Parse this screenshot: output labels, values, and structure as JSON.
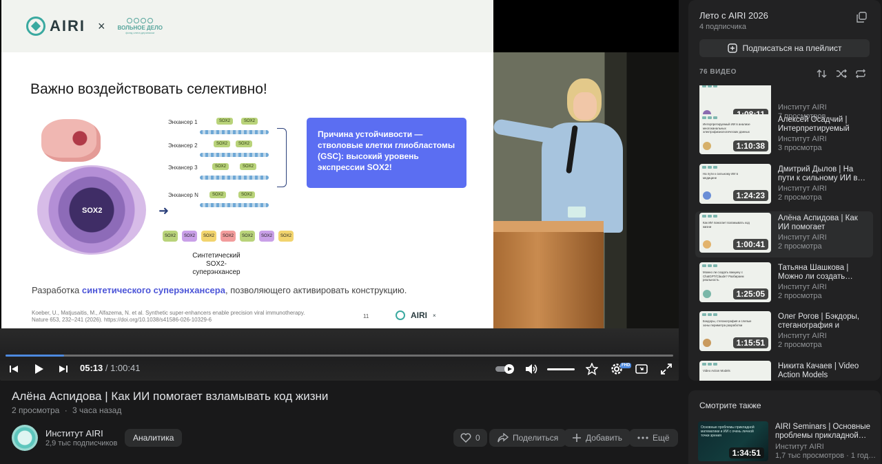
{
  "slide": {
    "heading": "Важно воздействовать селективно!",
    "x_sign": "×",
    "airi_logo": "AIRI",
    "partner_logo": "ВОЛЬНОЕ ДЕЛО",
    "partner_sub": "фонд олега дерипаски",
    "enhancers": [
      "Энхансер 1",
      "Энхансер 2",
      "Энхансер 3",
      "Энхансер N"
    ],
    "sox_label": "SOX2",
    "synthetic_label": "Синтетический SOX2-суперэнхансер",
    "blue_box": "Причина устойчивости — стволовые клетки глиобластомы (GSC): высокий уровень экспрессии SOX2!",
    "dev_prefix": "Разработка ",
    "dev_bold": "синтетического суперэнхансера",
    "dev_suffix": ", позволяющего активировать конструкцию.",
    "cite_line1": "Koeber, U., Matjusaitis, M., Alfazema, N. et al. Synthetic super-enhancers enable precision viral immunotherapy.",
    "cite_line2": "Nature 653, 232–241 (2026). https://doi.org/10.1038/s41586-026-10329-6",
    "page_number": "11"
  },
  "player": {
    "current_time": "05:13",
    "separator": " / ",
    "duration": "1:00:41",
    "progress_fraction": 0.088,
    "hd_badge": "FHD",
    "accent": "#4d8ae0"
  },
  "video": {
    "title": "Алёна Аспидова | Как ИИ помогает взламывать код жизни",
    "views": "2 просмотра",
    "dot": "·",
    "age": "3 часа назад",
    "channel_name": "Институт AIRI",
    "channel_subs": "2,9 тыс подписчиков",
    "analytics_label": "Аналитика",
    "likes": "0",
    "share_label": "Поделиться",
    "add_label": "Добавить",
    "more_label": "Ещё"
  },
  "playlist": {
    "title": "Лето с AIRI 2026",
    "subscribers": "4 подписчика",
    "subscribe_label": "Подписаться на плейлист",
    "count": "76 ВИДЕО",
    "items": [
      {
        "title": "",
        "channel": "Институт AIRI",
        "views": "7 просмотров",
        "duration": "1:08:11",
        "thumb_text": ""
      },
      {
        "title": "Алексей Осадчий | Интерпретируемый ИИ…",
        "channel": "Институт AIRI",
        "views": "3 просмотра",
        "duration": "1:10:38",
        "thumb_text": "Интерпретируемый ИИ в анализе многоканальных электрофизиологических данных"
      },
      {
        "title": "Дмитрий Дылов | На пути к сильному ИИ в…",
        "channel": "Институт AIRI",
        "views": "2 просмотра",
        "duration": "1:24:23",
        "thumb_text": "На пути к сильному ИИ в медицине"
      },
      {
        "title": "Алёна Аспидова | Как ИИ помогает взламыват…",
        "channel": "Институт AIRI",
        "views": "2 просмотра",
        "duration": "1:00:41",
        "thumb_text": "Как ИИ помогает взламывать код жизни"
      },
      {
        "title": "Татьяна Шашкова | Можно ли создать…",
        "channel": "Институт AIRI",
        "views": "2 просмотра",
        "duration": "1:25:05",
        "thumb_text": "Можно ли создать вакцину с ChatGPT/Claude? Разбираем реальность"
      },
      {
        "title": "Олег Рогов | Бэкдоры, стеганография и слепы…",
        "channel": "Институт AIRI",
        "views": "2 просмотра",
        "duration": "1:15:51",
        "thumb_text": "Бэкдоры, стеганография и слепые зоны периметра разработки"
      },
      {
        "title": "Никита Качаев | Video Action Models",
        "channel": "",
        "views": "",
        "duration": "",
        "thumb_text": "Video Action Models"
      }
    ]
  },
  "see_also": {
    "title": "Смотрите также",
    "video_title": "AIRI Seminars | Основные проблемы прикладной…",
    "channel": "Институт AIRI",
    "views": "1,7 тыс просмотров · 1 год…",
    "duration": "1:34:51",
    "thumb_text": "Основные проблемы прикладной математики и ИИ с очень личной точки зрения"
  }
}
